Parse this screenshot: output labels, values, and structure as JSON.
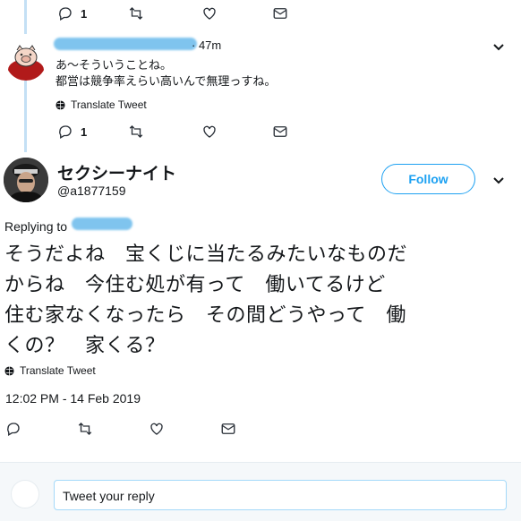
{
  "prev_tweet": {
    "reply_count": "1"
  },
  "reply_tweet": {
    "time": "· 47m",
    "text_line1": "あ～そういうことね。",
    "text_line2": "都営は競争率えらい高いんで無理っすね。",
    "translate_label": "Translate Tweet",
    "reply_count": "1"
  },
  "main_tweet": {
    "display_name": "セクシーナイト",
    "handle": "@a1877159",
    "follow_label": "Follow",
    "replying_to_label": "Replying to",
    "text_lines": [
      "そうだよね　宝くじに当たるみたいなものだ",
      "からね　今住む処が有って　働いてるけど",
      "住む家なくなったら　その間どうやって　働",
      "くの？　家くる？"
    ],
    "translate_label": "Translate Tweet",
    "timestamp": "12:02 PM - 14 Feb 2019"
  },
  "reply_box": {
    "placeholder": "Tweet your reply"
  },
  "colors": {
    "accent": "#1da1f2",
    "thread_line": "#c4e0f5",
    "redacted": "#7fc4ee"
  }
}
